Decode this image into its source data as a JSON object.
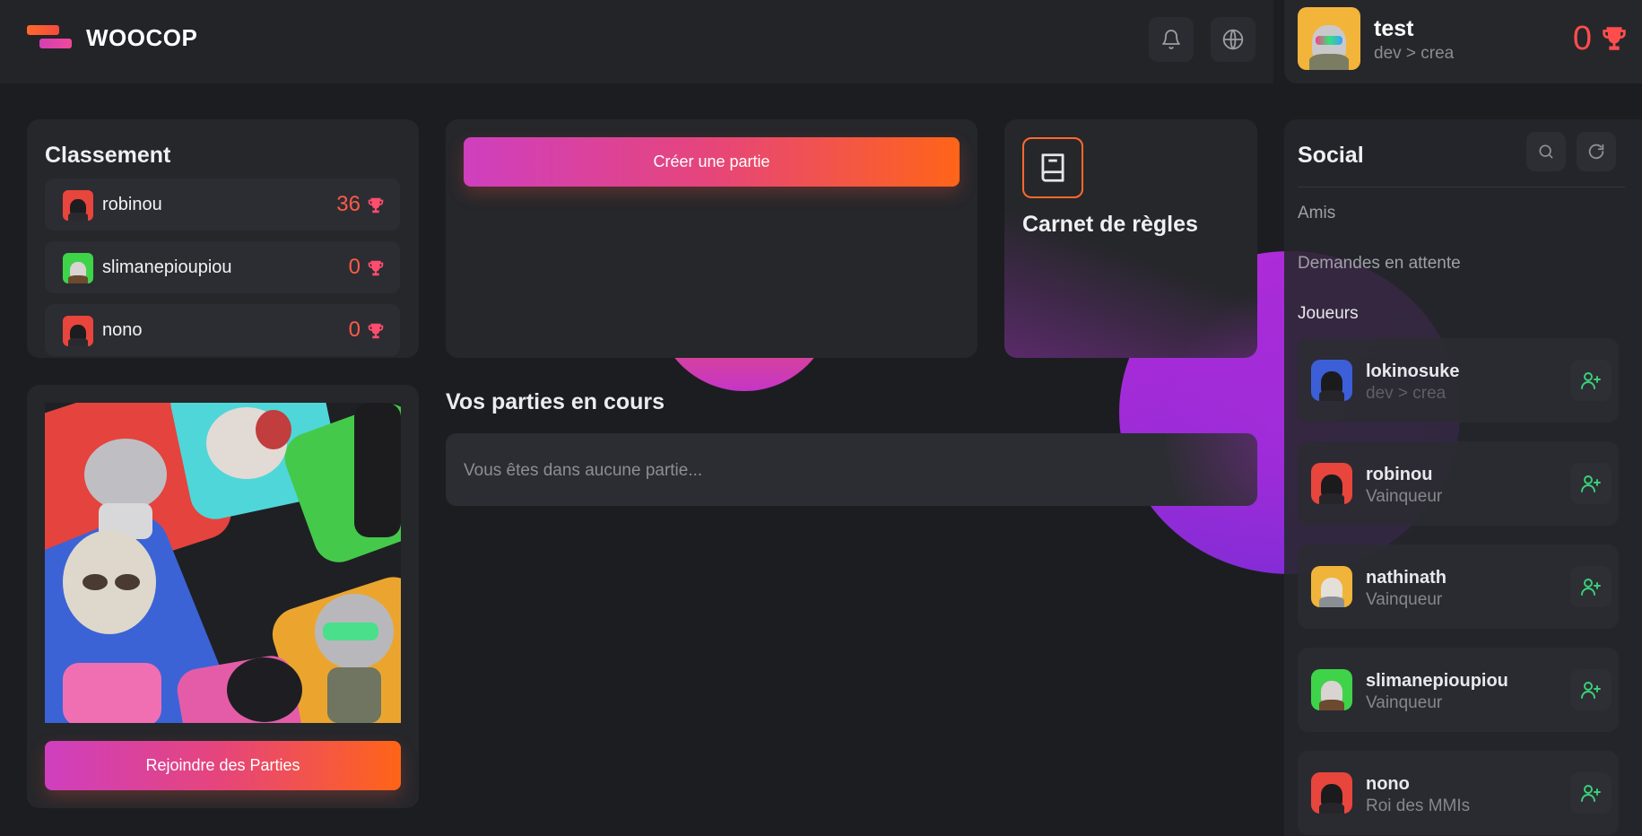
{
  "colors": {
    "accent_red": "#ff4d4d",
    "add_green": "#3ad17a",
    "rules_orange": "#ff6a2c"
  },
  "header": {
    "brand": "WOOCOP",
    "icons": [
      "bell-icon",
      "globe-icon"
    ],
    "user": {
      "name": "test",
      "subtitle": "dev > crea",
      "score": "0"
    }
  },
  "leaderboard": {
    "title": "Classement",
    "rows": [
      {
        "name": "robinou",
        "score": "36"
      },
      {
        "name": "slimanepioupiou",
        "score": "0"
      },
      {
        "name": "nono",
        "score": "0"
      }
    ]
  },
  "create_game": {
    "button": "Créer une partie"
  },
  "rules": {
    "title": "Carnet de règles"
  },
  "join_card": {
    "button": "Rejoindre des Parties"
  },
  "games": {
    "title": "Vos parties en cours",
    "empty": "Vous êtes dans aucune partie..."
  },
  "social": {
    "title": "Social",
    "links": [
      "Amis",
      "Demandes en attente",
      "Joueurs"
    ],
    "players": [
      {
        "name": "lokinosuke",
        "subtitle": "dev > crea"
      },
      {
        "name": "robinou",
        "subtitle": "Vainqueur"
      },
      {
        "name": "nathinath",
        "subtitle": "Vainqueur"
      },
      {
        "name": "slimanepioupiou",
        "subtitle": "Vainqueur"
      },
      {
        "name": "nono",
        "subtitle": "Roi des MMIs"
      }
    ]
  }
}
